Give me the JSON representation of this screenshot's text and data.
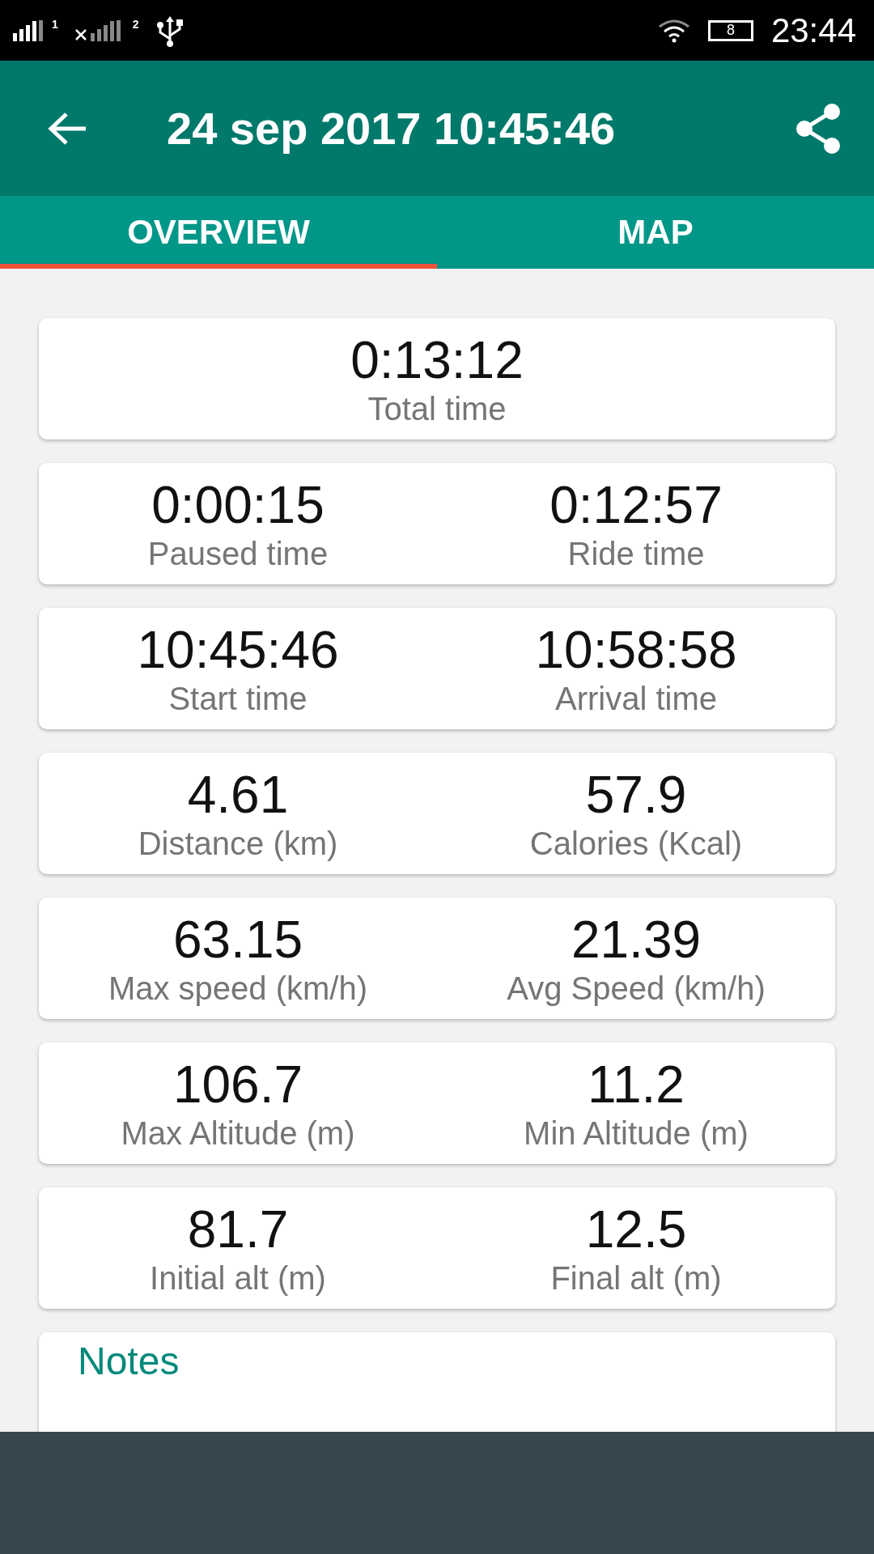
{
  "status_bar": {
    "sim1_label": "1",
    "sim2_label": "2",
    "battery": "8",
    "time": "23:44"
  },
  "app_bar": {
    "title": "24 sep 2017 10:45:46"
  },
  "tabs": [
    {
      "label": "OVERVIEW",
      "selected": true
    },
    {
      "label": "MAP",
      "selected": false
    }
  ],
  "cards": [
    {
      "stats": [
        {
          "value": "0:13:12",
          "label": "Total time"
        }
      ]
    },
    {
      "stats": [
        {
          "value": "0:00:15",
          "label": "Paused time"
        },
        {
          "value": "0:12:57",
          "label": "Ride time"
        }
      ]
    },
    {
      "stats": [
        {
          "value": "10:45:46",
          "label": "Start time"
        },
        {
          "value": "10:58:58",
          "label": "Arrival time"
        }
      ]
    },
    {
      "stats": [
        {
          "value": "4.61",
          "label": "Distance (km)"
        },
        {
          "value": "57.9",
          "label": "Calories (Kcal)"
        }
      ]
    },
    {
      "stats": [
        {
          "value": "63.15",
          "label": "Max speed (km/h)"
        },
        {
          "value": "21.39",
          "label": "Avg Speed (km/h)"
        }
      ]
    },
    {
      "stats": [
        {
          "value": "106.7",
          "label": "Max Altitude (m)"
        },
        {
          "value": "11.2",
          "label": "Min Altitude (m)"
        }
      ]
    },
    {
      "stats": [
        {
          "value": "81.7",
          "label": "Initial alt (m)"
        },
        {
          "value": "12.5",
          "label": "Final alt (m)"
        }
      ]
    }
  ],
  "notes": {
    "title": "Notes"
  }
}
